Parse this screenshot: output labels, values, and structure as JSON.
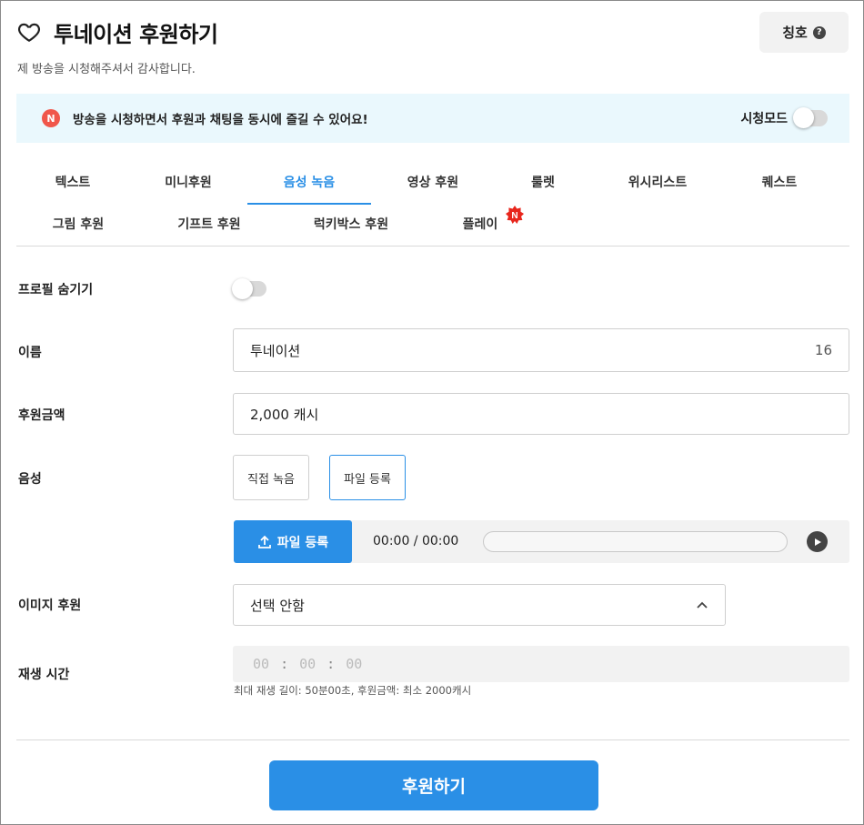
{
  "header": {
    "title": "투네이션 후원하기",
    "subtitle": "제 방송을 시청해주셔서 감사합니다.",
    "title_button": "칭호",
    "title_button_icon": "?"
  },
  "notice": {
    "badge": "N",
    "text": "방송을 시청하면서 후원과 채팅을 동시에 즐길 수 있어요!",
    "watch_mode_label": "시청모드"
  },
  "tabs": [
    {
      "label": "텍스트"
    },
    {
      "label": "미니후원"
    },
    {
      "label": "음성 녹음"
    },
    {
      "label": "영상 후원"
    },
    {
      "label": "룰렛"
    },
    {
      "label": "위시리스트"
    },
    {
      "label": "퀘스트"
    },
    {
      "label": "그림 후원"
    },
    {
      "label": "기프트 후원"
    },
    {
      "label": "럭키박스 후원"
    },
    {
      "label": "플레이"
    }
  ],
  "active_tab": "음성 녹음",
  "form": {
    "hide_profile_label": "프로필 숨기기",
    "name_label": "이름",
    "name_value": "투네이션",
    "name_count": "16",
    "amount_label": "후원금액",
    "amount_value": "2,000 캐시",
    "voice_label": "음성",
    "voice_options": [
      "직접 녹음",
      "파일 등록"
    ],
    "upload_button": "파일 등록",
    "player_time": "00:00 / 00:00",
    "image_label": "이미지 후원",
    "image_value": "선택 안함",
    "play_time_label": "재생 시간",
    "time_hh": "00",
    "time_mm": "00",
    "time_ss": "00",
    "time_sep": ":",
    "hint": "최대 재생 길이: 50분00초, 후원금액: 최소 2000캐시"
  },
  "submit_label": "후원하기",
  "colors": {
    "accent": "#2a8fe6",
    "notice_bg": "#eaf8fd",
    "badge_red": "#f0564a"
  }
}
